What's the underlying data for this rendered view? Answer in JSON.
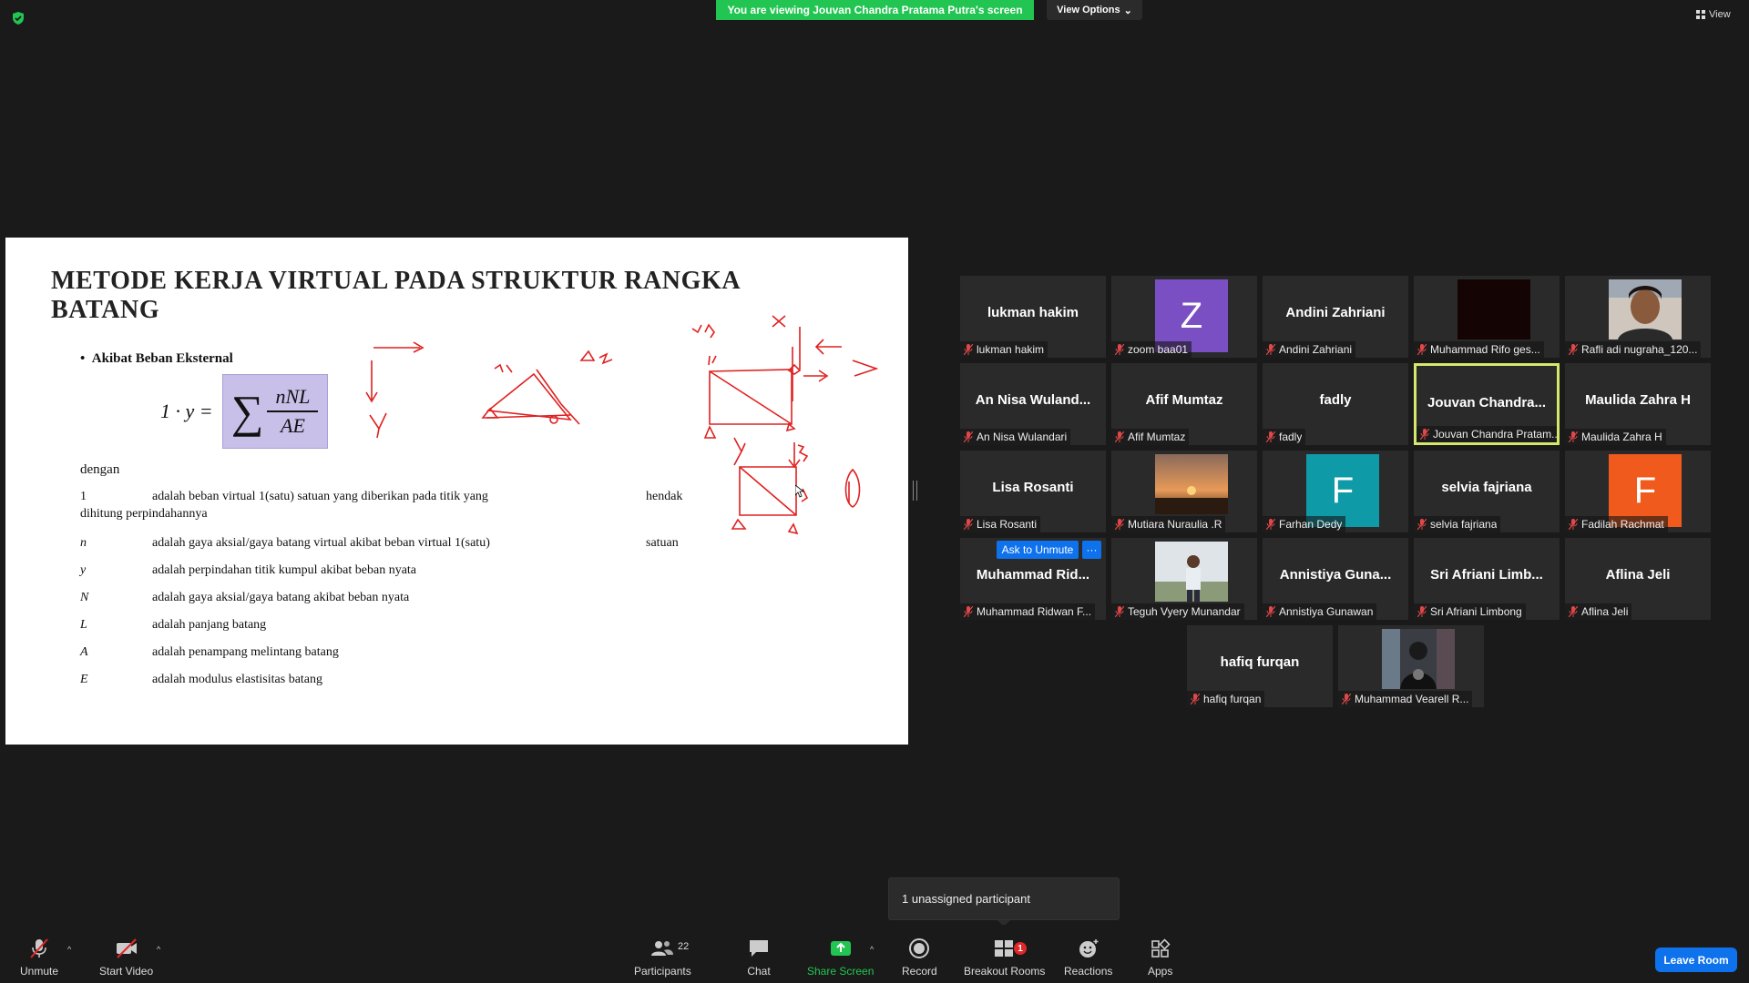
{
  "top": {
    "banner": "You are viewing Jouvan Chandra Pratama Putra's screen",
    "view_options": "View Options",
    "view": "View"
  },
  "slide": {
    "title": "METODE KERJA VIRTUAL PADA STRUKTUR RANGKA BATANG",
    "bullet": "Akibat Beban Eksternal",
    "formula_lhs": "1 · y =",
    "formula_num": "nNL",
    "formula_den": "AE",
    "dengan": "dengan",
    "definitions": [
      {
        "sym": "1",
        "text": "adalah beban virtual 1(satu) satuan yang diberikan pada titik yang",
        "extra": "hendak",
        "cont": "dihitung perpindahannya"
      },
      {
        "sym": "n",
        "text": "adalah gaya aksial/gaya batang virtual akibat beban virtual 1(satu)",
        "extra": "satuan",
        "cont": ""
      },
      {
        "sym": "y",
        "text": "adalah perpindahan titik kumpul akibat beban nyata",
        "extra": "",
        "cont": ""
      },
      {
        "sym": "N",
        "text": "adalah gaya aksial/gaya batang akibat beban nyata",
        "extra": "",
        "cont": ""
      },
      {
        "sym": "L",
        "text": "adalah panjang batang",
        "extra": "",
        "cont": ""
      },
      {
        "sym": "A",
        "text": "adalah penampang melintang batang",
        "extra": "",
        "cont": ""
      },
      {
        "sym": "E",
        "text": "adalah modulus elastisitas batang",
        "extra": "",
        "cont": ""
      }
    ]
  },
  "participants": [
    {
      "big": "lukman hakim",
      "name": "lukman hakim"
    },
    {
      "avatar_letter": "Z",
      "avatar_color": "#7b4fc4",
      "name": "zoom baa01"
    },
    {
      "big": "Andini Zahriani",
      "name": "Andini Zahriani"
    },
    {
      "photo": "dark",
      "name": "Muhammad Rifo ges..."
    },
    {
      "photo": "person",
      "name": "Rafli adi nugraha_120..."
    },
    {
      "big": "An Nisa Wuland...",
      "name": "An Nisa Wulandari"
    },
    {
      "big": "Afif Mumtaz",
      "name": "Afif Mumtaz"
    },
    {
      "big": "fadly",
      "name": "fadly"
    },
    {
      "big": "Jouvan Chandra...",
      "name": "Jouvan Chandra Pratam...",
      "active": true
    },
    {
      "big": "Maulida Zahra H",
      "name": "Maulida Zahra H"
    },
    {
      "big": "Lisa Rosanti",
      "name": "Lisa Rosanti"
    },
    {
      "photo": "sunset",
      "name": "Mutiara Nuraulia .R"
    },
    {
      "avatar_letter": "F",
      "avatar_color": "#0f9aa8",
      "name": "Farhan Dedy"
    },
    {
      "big": "selvia fajriana",
      "name": "selvia fajriana"
    },
    {
      "avatar_letter": "F",
      "avatar_color": "#f05a1c",
      "name": "Fadilah Rachmat"
    },
    {
      "big": "Muhammad Rid...",
      "name": "Muhammad Ridwan F..."
    },
    {
      "photo": "outdoor",
      "name": "Teguh Vyery Munandar"
    },
    {
      "big": "Annistiya Guna...",
      "name": "Annistiya Gunawan"
    },
    {
      "big": "Sri Afriani Limb...",
      "name": "Sri Afriani Limbong"
    },
    {
      "big": "Aflina Jeli",
      "name": "Aflina Jeli"
    },
    {
      "big": "hafiq furqan",
      "name": "hafiq furqan"
    },
    {
      "photo": "group",
      "name": "Muhammad Vearell R..."
    }
  ],
  "ask_unmute": "Ask to Unmute",
  "more": "···",
  "tooltip": "1 unassigned participant",
  "toolbar": {
    "unmute": "Unmute",
    "start_video": "Start Video",
    "participants": "Participants",
    "participants_count": "22",
    "chat": "Chat",
    "share_screen": "Share Screen",
    "record": "Record",
    "breakout_rooms": "Breakout Rooms",
    "breakout_badge": "1",
    "reactions": "Reactions",
    "apps": "Apps",
    "leave_room": "Leave Room"
  },
  "colors": {
    "banner": "#23c552",
    "accent_blue": "#0e72ed",
    "active_speaker": "#d6e86c",
    "ink": "#e02020"
  },
  "icons": [
    "shield-icon",
    "chevron-down-icon",
    "grid-icon",
    "muted-mic-icon",
    "video-off-icon",
    "participants-icon",
    "chat-icon",
    "share-screen-icon",
    "record-icon",
    "breakout-rooms-icon",
    "reactions-icon",
    "apps-icon"
  ]
}
